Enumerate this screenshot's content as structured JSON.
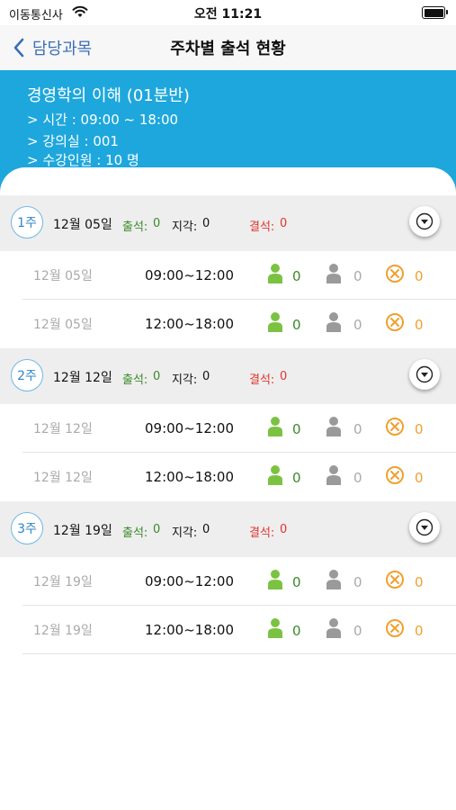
{
  "status_bar": {
    "carrier": "이동통신사",
    "time": "오전 11:21"
  },
  "nav": {
    "back_label": "담당과목",
    "title": "주차별 출석 현황"
  },
  "course": {
    "name": "경영학의 이해 (01분반)",
    "time": "> 시간 : 09:00 ~ 18:00",
    "room": "> 강의실 : 001",
    "enrollment": "> 수강인원 : 10 명"
  },
  "weeks": [
    {
      "badge": "1주",
      "date": "12월 05일",
      "attend_label": "출석:",
      "attend": "0",
      "late_label": "지각:",
      "late": "0",
      "absent_label": "결석:",
      "absent": "0",
      "sessions": [
        {
          "date": "12월 05일",
          "time": "09:00~12:00",
          "present": "0",
          "late": "0",
          "absent": "0"
        },
        {
          "date": "12월 05일",
          "time": "12:00~18:00",
          "present": "0",
          "late": "0",
          "absent": "0"
        }
      ]
    },
    {
      "badge": "2주",
      "date": "12월 12일",
      "attend_label": "출석:",
      "attend": "0",
      "late_label": "지각:",
      "late": "0",
      "absent_label": "결석:",
      "absent": "0",
      "sessions": [
        {
          "date": "12월 12일",
          "time": "09:00~12:00",
          "present": "0",
          "late": "0",
          "absent": "0"
        },
        {
          "date": "12월 12일",
          "time": "12:00~18:00",
          "present": "0",
          "late": "0",
          "absent": "0"
        }
      ]
    },
    {
      "badge": "3주",
      "date": "12월 19일",
      "attend_label": "출석:",
      "attend": "0",
      "late_label": "지각:",
      "late": "0",
      "absent_label": "결석:",
      "absent": "0",
      "sessions": [
        {
          "date": "12월 19일",
          "time": "09:00~12:00",
          "present": "0",
          "late": "0",
          "absent": "0"
        },
        {
          "date": "12월 19일",
          "time": "12:00~18:00",
          "present": "0",
          "late": "0",
          "absent": "0"
        }
      ]
    }
  ],
  "icons": {
    "present": "person-green-icon",
    "late": "person-gray-icon",
    "absent": "x-circle-orange-icon",
    "expand": "chevron-down-circle-icon",
    "back": "chevron-left-icon"
  },
  "colors": {
    "header_bg": "#1ea7dc",
    "present": "#7cc242",
    "late": "#9a9a9a",
    "absent": "#f0a030",
    "absent_text": "#e0352f"
  }
}
